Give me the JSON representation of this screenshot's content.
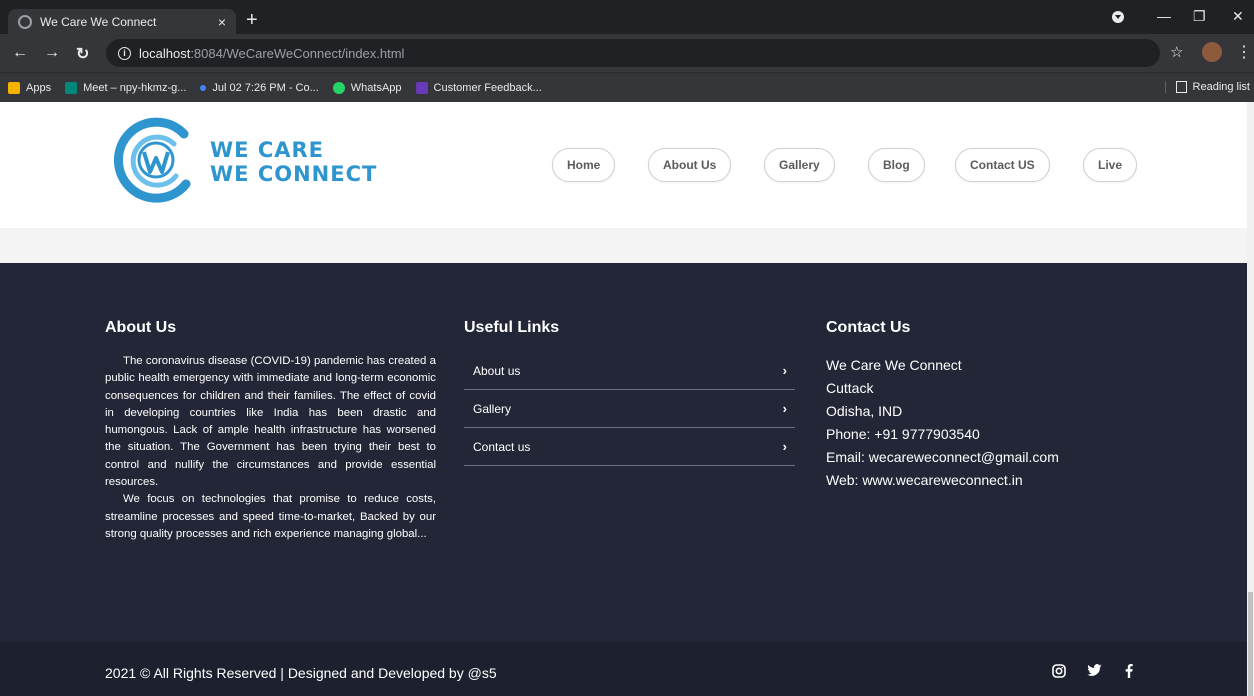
{
  "browser": {
    "tab_title": "We Care We Connect",
    "tab_close": "×",
    "new_tab": "+",
    "url_host": "localhost",
    "url_rest": ":8084/WeCareWeConnect/index.html",
    "bookmarks": [
      {
        "label": "Apps",
        "color": "#f4b400"
      },
      {
        "label": "Meet – npy-hkmz-g...",
        "color": "#00897b"
      },
      {
        "label": "Jul 02 7:26 PM - Co...",
        "color": "#4285f4"
      },
      {
        "label": "WhatsApp",
        "color": "#25d366"
      },
      {
        "label": "Customer Feedback...",
        "color": "#673ab7"
      }
    ],
    "reading_list": "Reading list"
  },
  "header": {
    "logo_line1": "WE CARE",
    "logo_line2": "WE CONNECT",
    "nav": [
      "Home",
      "About Us",
      "Gallery",
      "Blog",
      "Contact US",
      "Live"
    ]
  },
  "footer": {
    "about_title": "About Us",
    "about_p1": "The coronavirus disease (COVID-19) pandemic has created a public health emergency with immediate and long-term economic consequences for children and their families. The effect of covid in developing countries like India has been drastic and humongous. Lack of ample health infrastructure has worsened the situation. The Government has been trying their best to control and nullify the circumstances and provide essential resources.",
    "about_p2": "We focus on technologies that promise to reduce costs, streamline processes and speed time-to-market, Backed by our strong quality processes and rich experience managing global...",
    "links_title": "Useful Links",
    "links": [
      "About us",
      "Gallery",
      "Contact us"
    ],
    "contact_title": "Contact Us",
    "contact_name": "We Care We Connect",
    "contact_city": "Cuttack",
    "contact_state": "Odisha, IND",
    "contact_phone_label": "Phone: ",
    "contact_phone": "+91 9777903540",
    "contact_email_label": "Email: ",
    "contact_email": "wecareweconnect@gmail.com",
    "contact_web_label": "Web: ",
    "contact_web": "www.wecareweconnect.in",
    "copyright": "2021 © All Rights Reserved | Designed and Developed by @s5"
  },
  "icons": {
    "social": [
      "instagram-icon",
      "twitter-icon",
      "facebook-icon"
    ]
  },
  "colors": {
    "brand_blue": "#2f95cf",
    "footer_bg": "#222637",
    "bottombar_bg": "#1c202f"
  }
}
